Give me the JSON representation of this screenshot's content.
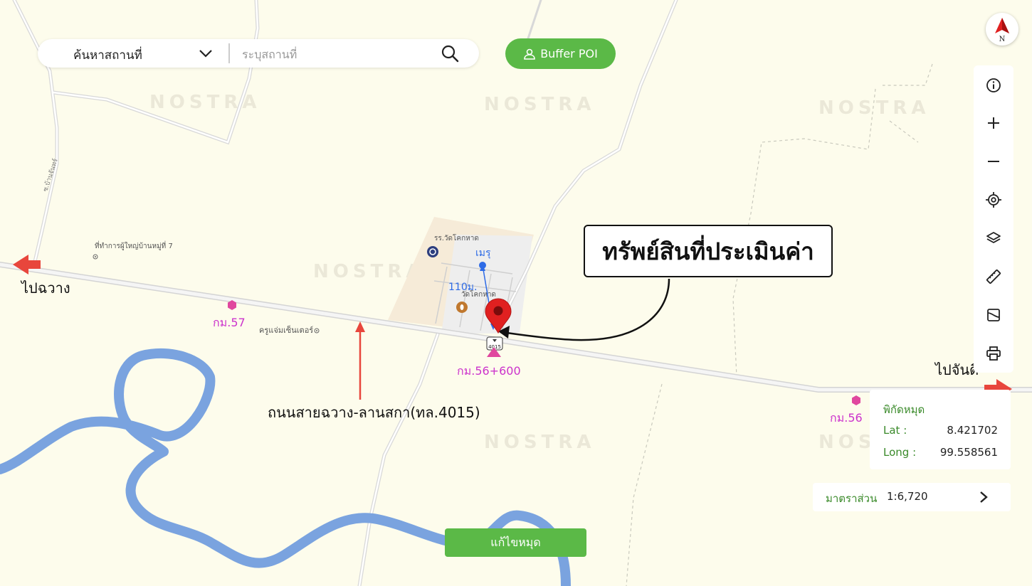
{
  "search": {
    "category": "ค้นหาสถานที่",
    "placeholder": "ระบุสถานที่"
  },
  "buffer_button": "Buffer POI",
  "compass_letter": "N",
  "toolbar_icons": [
    "info-icon",
    "zoom-in-icon",
    "zoom-out-icon",
    "locate-icon",
    "layers-icon",
    "ruler-icon",
    "map-type-icon",
    "print-icon"
  ],
  "map": {
    "direction_left": "ไปฉวาง",
    "direction_right": "ไปจันดี",
    "road_label": "ถนนสายฉวาง-ลานสกา(ทล.4015)",
    "km_57": "กม.57",
    "km_56_600": "กม.56+600",
    "km_56": "กม.56",
    "poi_village_head": "ที่ทำการผู้ใหญ่บ้านหมู่ที่ 7",
    "poi_shop": "ครูแจ่มเซ็นเตอร์",
    "poi_school": "รร.วัดโคกหาด",
    "poi_temple": "วัดโคกหาด",
    "poi_meru": "เมรุ",
    "distance": "110ม.",
    "road_shield": "4015",
    "side_road": "ซ.บ้านจันทร์",
    "watermark": "NOSTRA",
    "callout": "ทรัพย์สินที่ประเมินค่า"
  },
  "coords": {
    "title": "พิกัดหมุด",
    "lat_label": "Lat :",
    "lat_value": "8.421702",
    "long_label": "Long :",
    "long_value": "99.558561"
  },
  "scale": {
    "label": "มาตราส่วน",
    "value": "1:6,720"
  },
  "edit_button": "แก้ไขหมุด",
  "colors": {
    "map_bg": "#fdfcec",
    "river": "#7aa3df",
    "accent_green": "#5bb947",
    "pin_red": "#e02020",
    "arrow_red": "#e8463c",
    "km_magenta": "#cc33cc"
  }
}
